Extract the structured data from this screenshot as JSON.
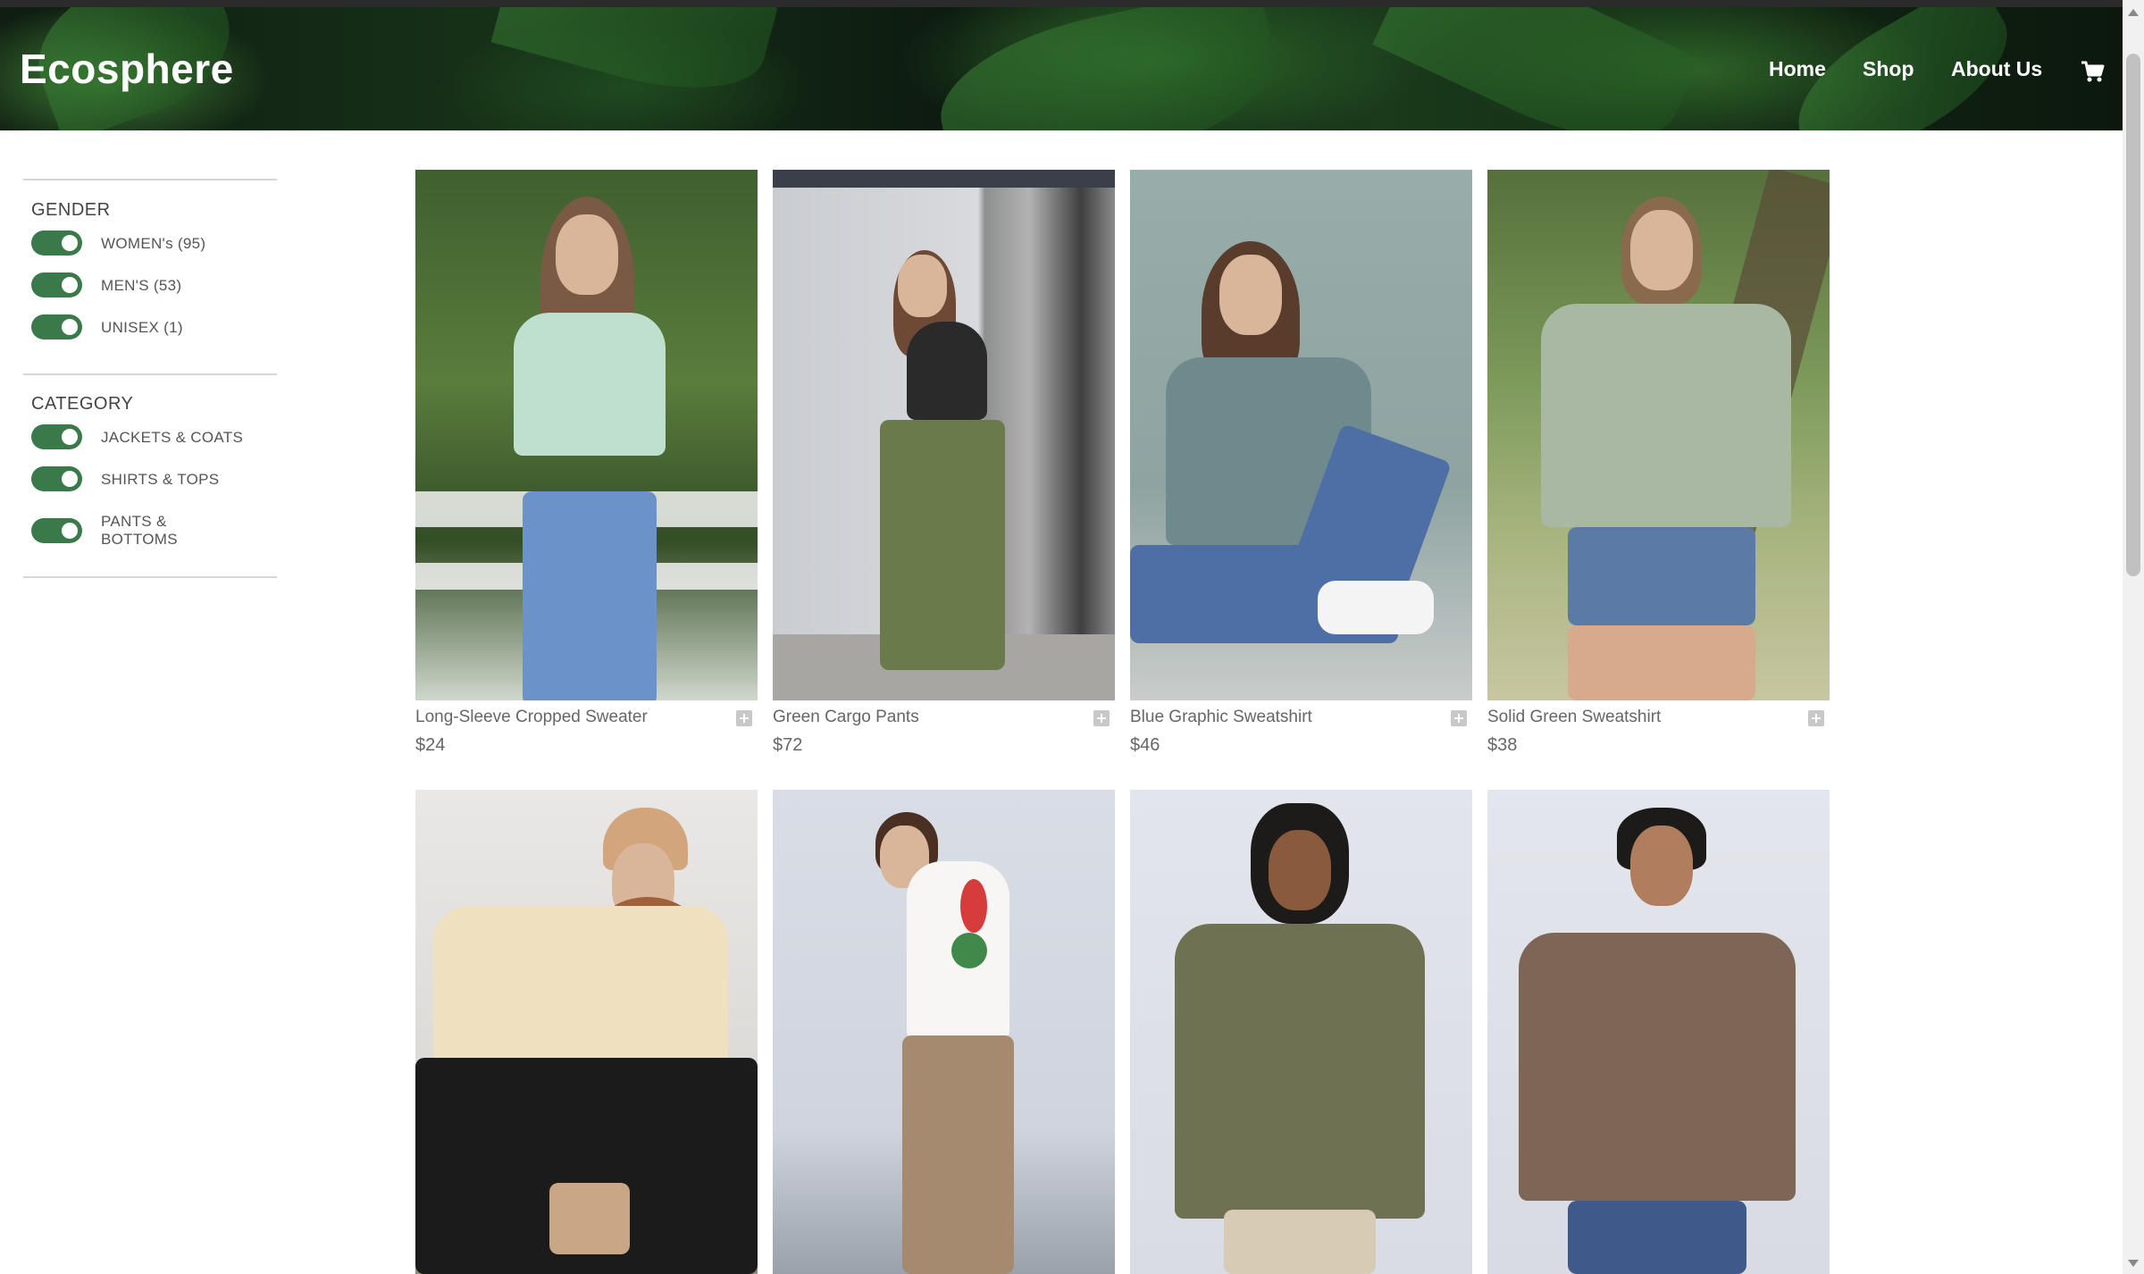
{
  "header": {
    "logo": "Ecosphere",
    "nav": [
      "Home",
      "Shop",
      "About Us"
    ],
    "cart_icon": "cart-icon"
  },
  "filters": {
    "gender": {
      "title": "GENDER",
      "options": [
        {
          "label": "WOMEN's (95)",
          "enabled": true
        },
        {
          "label": "MEN'S (53)",
          "enabled": true
        },
        {
          "label": "UNISEX (1)",
          "enabled": true
        }
      ]
    },
    "category": {
      "title": "CATEGORY",
      "options": [
        {
          "label": "JACKETS & COATS",
          "enabled": true
        },
        {
          "label": "SHIRTS & TOPS",
          "enabled": true
        },
        {
          "label": "PANTS & BOTTOMS",
          "enabled": true
        }
      ]
    }
  },
  "products": [
    {
      "name": "Long-Sleeve Cropped Sweater",
      "price": "$24"
    },
    {
      "name": "Green Cargo Pants",
      "price": "$72"
    },
    {
      "name": "Blue Graphic Sweatshirt",
      "price": "$46"
    },
    {
      "name": "Solid Green Sweatshirt",
      "price": "$38"
    },
    {
      "name": "",
      "price": ""
    },
    {
      "name": "",
      "price": ""
    },
    {
      "name": "",
      "price": ""
    },
    {
      "name": "",
      "price": ""
    }
  ],
  "colors": {
    "toggle_on": "#3a7a4a",
    "header_bg": "#14291a"
  }
}
